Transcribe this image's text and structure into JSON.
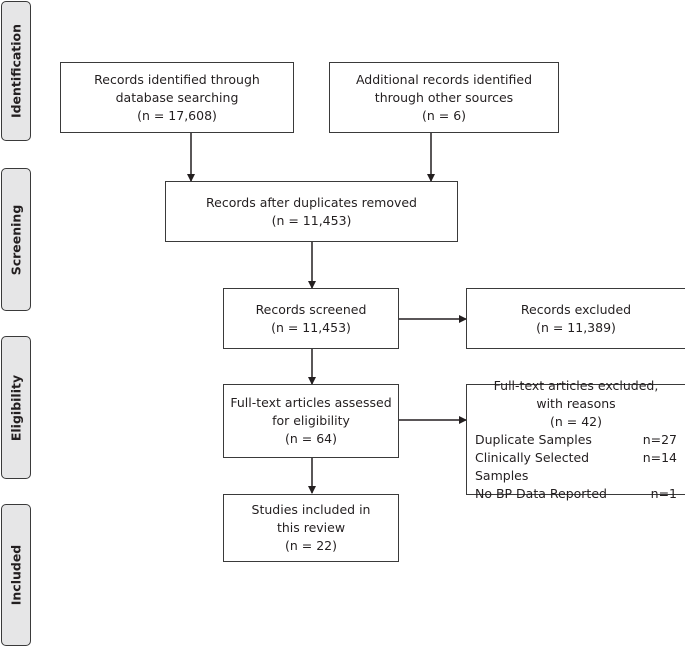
{
  "phases": [
    {
      "id": "identification",
      "label": "Identification"
    },
    {
      "id": "screening",
      "label": "Screening"
    },
    {
      "id": "eligibility",
      "label": "Eligibility"
    },
    {
      "id": "included",
      "label": "Included"
    }
  ],
  "boxes": {
    "database": {
      "lines": [
        "Records identified through",
        "database searching",
        "(n = 17,608)"
      ],
      "n": 17608
    },
    "other_sources": {
      "lines": [
        "Additional records identified",
        "through other sources",
        "(n = 6)"
      ],
      "n": 6
    },
    "duplicates_removed": {
      "lines": [
        "Records after duplicates removed",
        "(n = 11,453)"
      ],
      "n": 11453
    },
    "screened": {
      "lines": [
        "Records screened",
        "(n = 11,453)"
      ],
      "n": 11453
    },
    "excluded": {
      "lines": [
        "Records excluded",
        "(n =  11,389)"
      ],
      "n": 11389
    },
    "fulltext_assessed": {
      "lines": [
        "Full-text articles assessed",
        "for eligibility",
        "(n =  64)"
      ],
      "n": 64
    },
    "fulltext_excluded": {
      "lines": [
        "Full-text articles excluded,",
        "with reasons",
        "(n = 42)"
      ],
      "n": 42,
      "reasons": [
        {
          "label": "Duplicate Samples",
          "count": "n=27"
        },
        {
          "label": "Clinically Selected Samples",
          "count": "n=14"
        },
        {
          "label": "No BP Data Reported",
          "count": "n=1"
        }
      ]
    },
    "included": {
      "lines": [
        "Studies included in",
        "this review",
        "(n =  22)"
      ],
      "n": 22
    }
  },
  "colors": {
    "line": "#231f20",
    "phase_fill": "#e6e6e7",
    "box_border": "#3a3a3a"
  }
}
